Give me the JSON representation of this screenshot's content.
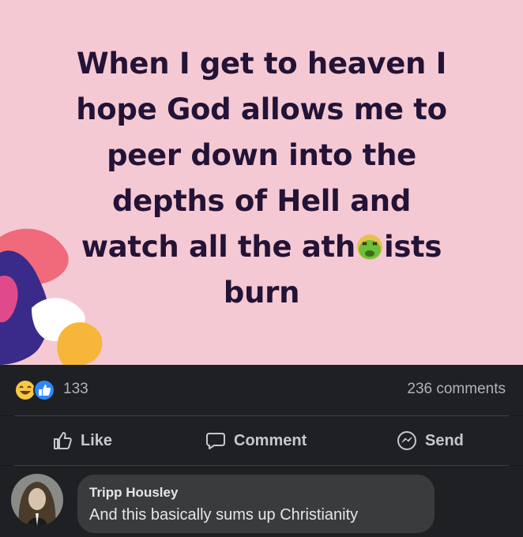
{
  "post": {
    "lines": [
      "When I get to heaven I",
      "hope God allows me to",
      "peer down into the",
      "depths of Hell and"
    ],
    "line5_before": "watch all the ath",
    "line5_emoji": "nauseated-face-emoji",
    "line5_after": "ists",
    "line6": "burn",
    "background_color": "#f5c9d3",
    "text_color": "#231336"
  },
  "reactions": {
    "icons": [
      "haha-reaction-icon",
      "like-reaction-icon"
    ],
    "count": "133",
    "comments": "236 comments"
  },
  "actions": {
    "like": "Like",
    "comment": "Comment",
    "send": "Send"
  },
  "comment": {
    "author": "Tripp Housley",
    "text": "And this basically sums up Christianity"
  }
}
